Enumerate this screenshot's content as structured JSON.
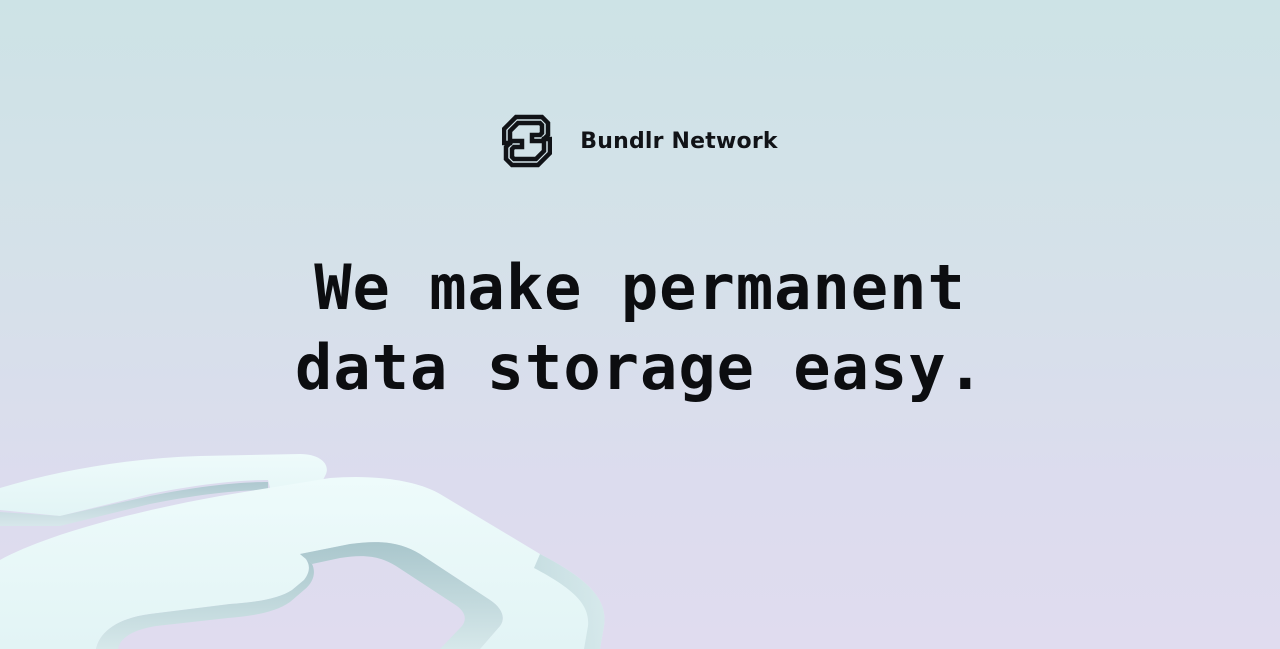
{
  "brand": {
    "name": "Bundlr Network",
    "logo_icon": "bundlr-logo-icon"
  },
  "hero": {
    "headline_line1": "We make permanent",
    "headline_line2": "data storage easy."
  },
  "colors": {
    "text": "#0c0d10",
    "background_top": "#cde3e6",
    "background_bottom": "#e0dcef",
    "decor_face": "#e8f8f8"
  }
}
